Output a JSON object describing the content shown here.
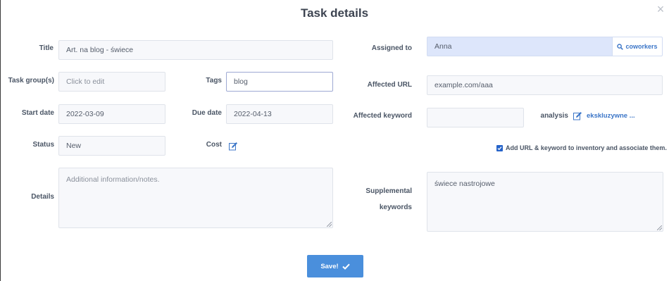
{
  "dialog": {
    "title": "Task details",
    "close_symbol": "×"
  },
  "labels": {
    "title": "Title",
    "task_groups": "Task group(s)",
    "tags": "Tags",
    "start_date": "Start date",
    "due_date": "Due date",
    "status": "Status",
    "cost": "Cost",
    "details": "Details",
    "assigned_to": "Assigned to",
    "affected_url": "Affected URL",
    "affected_keyword": "Affected keyword",
    "analysis": "analysis",
    "supplemental_keywords_line1": "Supplemental",
    "supplemental_keywords_line2": "keywords"
  },
  "fields": {
    "title_value": "Art. na blog - świece",
    "task_groups_placeholder": "Click to edit",
    "tags_value": "blog",
    "start_date_value": "2022-03-09",
    "due_date_value": "2022-04-13",
    "status_value": "New",
    "details_placeholder": "Additional information/notes.",
    "assigned_to_value": "Anna",
    "affected_url_value": "example.com/aaa",
    "affected_keyword_value": "",
    "analysis_link": "ekskluzywne ...",
    "supplemental_keywords_value": "świece nastrojowe"
  },
  "buttons": {
    "coworkers": "coworkers",
    "save": "Save!"
  },
  "checkbox": {
    "checked": true,
    "label": "Add URL & keyword to inventory and associate them."
  },
  "colors": {
    "accent": "#4a8fdc",
    "link": "#3c76c8",
    "assigned_bg": "#dde6fb"
  }
}
